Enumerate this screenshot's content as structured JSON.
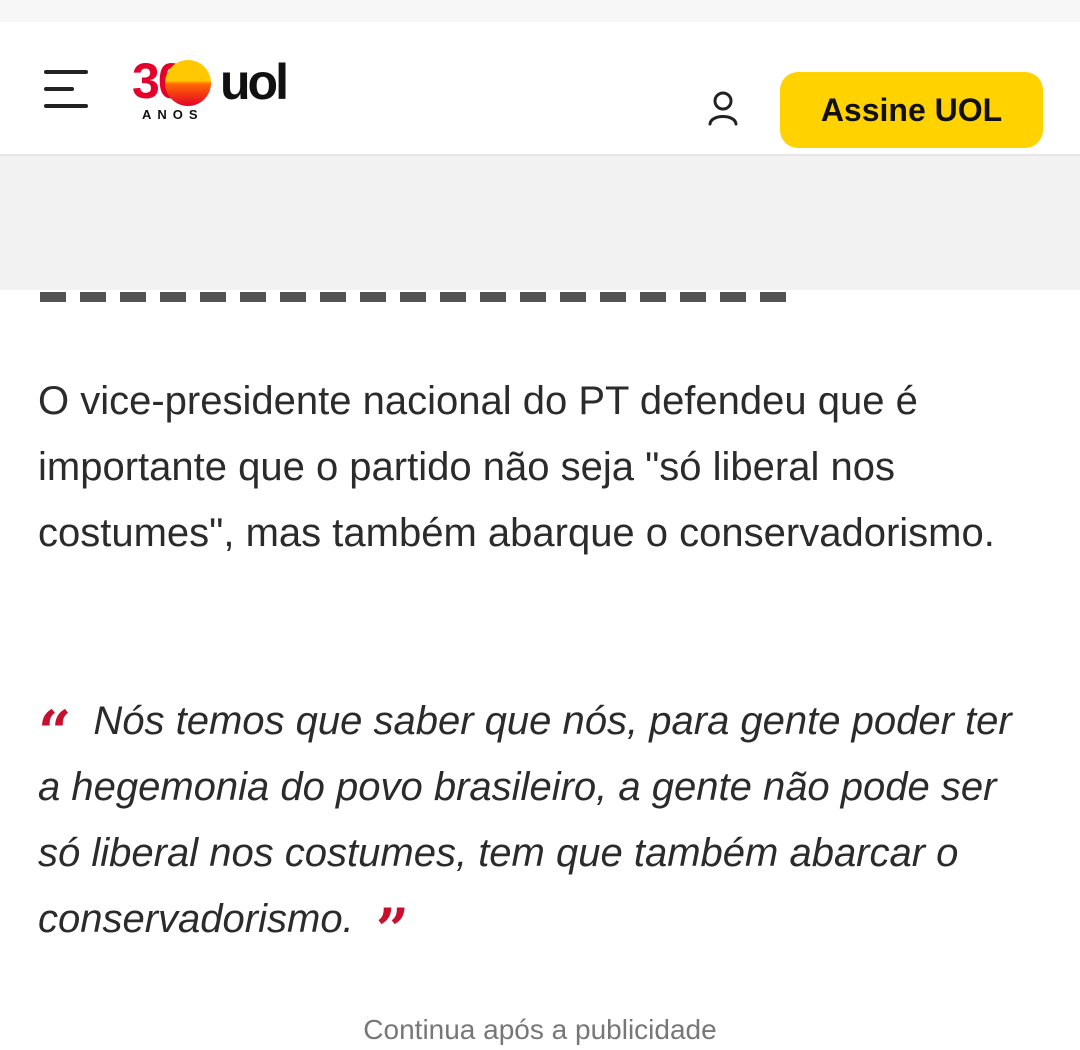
{
  "header": {
    "logo": {
      "number": "30",
      "brand": "uol",
      "tagline": "ANOS"
    },
    "subscribe_label": "Assine UOL",
    "menu_icon": "hamburger-menu-icon",
    "user_icon": "user-icon"
  },
  "article": {
    "paragraph": "O vice-presidente nacional do PT defendeu que é importante que o partido não seja \"só liberal nos costumes\", mas também abarque o conservadorismo.",
    "quote": {
      "open_mark": "“",
      "text": "Nós temos que saber que nós, para gente poder ter a hegemonia do povo brasileiro, a gente não pode ser só liberal nos costumes, tem que também abarcar o conservadorismo.",
      "close_mark": "”"
    },
    "continue_label": "Continua após a publicidade"
  },
  "colors": {
    "brand_red": "#e4002b",
    "brand_yellow": "#ffd200",
    "quote_red": "#c8102e"
  }
}
